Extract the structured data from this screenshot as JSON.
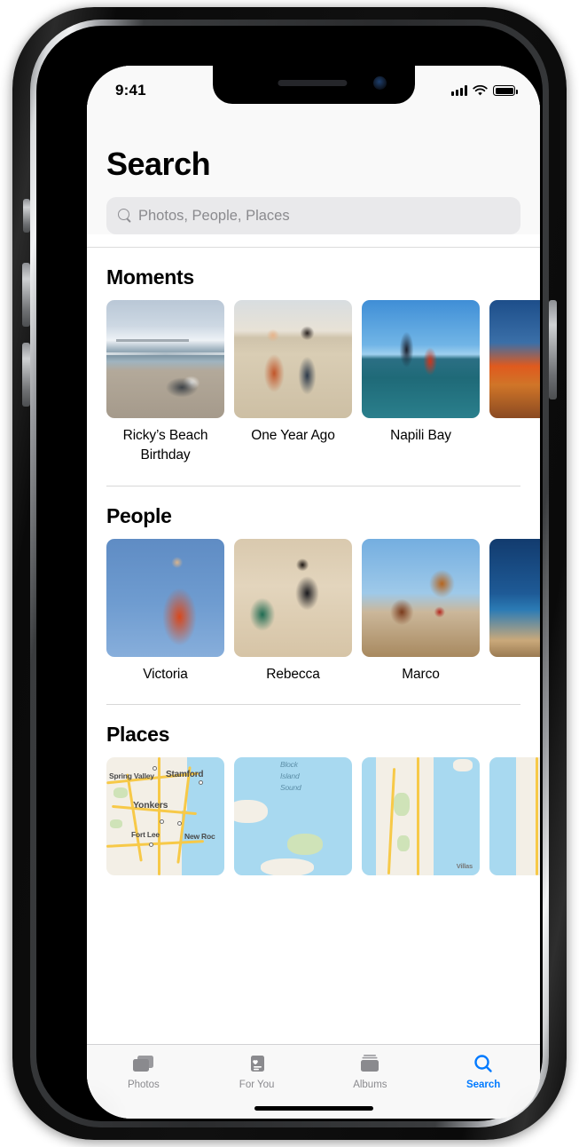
{
  "status_bar": {
    "time": "9:41",
    "cellular_icon": "signal-bars-icon",
    "wifi_icon": "wifi-icon",
    "battery_icon": "battery-icon"
  },
  "header": {
    "title": "Search",
    "search": {
      "placeholder": "Photos, People, Places",
      "value": "",
      "icon": "search-icon"
    }
  },
  "sections": [
    {
      "title": "Moments",
      "items": [
        {
          "label": "Ricky’s Beach Birthday",
          "art": "ph-dog"
        },
        {
          "label": "One Year Ago",
          "art": "ph-couple"
        },
        {
          "label": "Napili Bay",
          "art": "ph-jump"
        },
        {
          "label": "",
          "art": "ph-sunset"
        }
      ]
    },
    {
      "title": "People",
      "items": [
        {
          "label": "Victoria",
          "art": "ph-victoria"
        },
        {
          "label": "Rebecca",
          "art": "ph-rebecca"
        },
        {
          "label": "Marco",
          "art": "ph-marco"
        },
        {
          "label": "",
          "art": "ph-ocean"
        }
      ]
    },
    {
      "title": "Places",
      "items": [
        {
          "label": "",
          "art": "map"
        },
        {
          "label": "",
          "art": "map"
        },
        {
          "label": "",
          "art": "map"
        },
        {
          "label": "",
          "art": "map"
        }
      ]
    }
  ],
  "map_labels": {
    "tile1": [
      "Spring Valley",
      "Stamford",
      "Yonkers",
      "Fort Lee",
      "New Roc"
    ],
    "tile2": [
      "Block",
      "Island",
      "Sound"
    ],
    "tile3": [
      "Villas"
    ]
  },
  "tab_bar": {
    "tabs": [
      {
        "label": "Photos",
        "icon": "photos-stack-icon",
        "active": false
      },
      {
        "label": "For You",
        "icon": "heart-card-icon",
        "active": false
      },
      {
        "label": "Albums",
        "icon": "albums-stack-icon",
        "active": false
      },
      {
        "label": "Search",
        "icon": "magnifier-icon",
        "active": true
      }
    ]
  },
  "colors": {
    "accent": "#007aff",
    "inactive_tab": "#8a8a8e",
    "header_bg": "#f9f9f9",
    "search_field_bg": "#e9e9eb"
  }
}
